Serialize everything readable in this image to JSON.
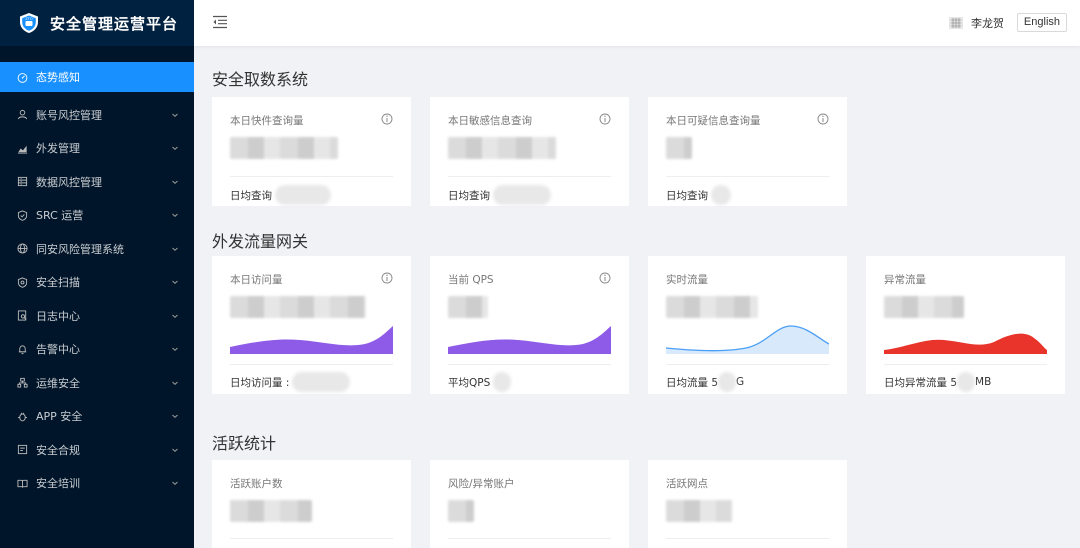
{
  "app": {
    "title": "安全管理运营平台"
  },
  "sidebar": {
    "items": [
      {
        "label": "态势感知",
        "icon": "dashboard-icon",
        "active": true
      },
      {
        "label": "账号风控管理",
        "icon": "user-icon"
      },
      {
        "label": "外发管理",
        "icon": "area-chart-icon"
      },
      {
        "label": "数据风控管理",
        "icon": "database-icon"
      },
      {
        "label": "SRC 运营",
        "icon": "shield-check-icon"
      },
      {
        "label": "同安风险管理系统",
        "icon": "global-icon"
      },
      {
        "label": "安全扫描",
        "icon": "safety-icon"
      },
      {
        "label": "日志中心",
        "icon": "file-search-icon"
      },
      {
        "label": "告警中心",
        "icon": "bell-icon"
      },
      {
        "label": "运维安全",
        "icon": "cluster-icon"
      },
      {
        "label": "APP 安全",
        "icon": "bug-icon"
      },
      {
        "label": "安全合规",
        "icon": "audit-icon"
      },
      {
        "label": "安全培训",
        "icon": "read-icon"
      }
    ]
  },
  "header": {
    "user_name": "李龙贺",
    "lang_button": "English"
  },
  "sections": {
    "s1": "安全取数系统",
    "s2": "外发流量网关",
    "s3": "活跃统计"
  },
  "cards": {
    "c1": {
      "label": "本日快件查询量",
      "footer": "日均查询"
    },
    "c2": {
      "label": "本日敏感信息查询",
      "footer": "日均查询"
    },
    "c3": {
      "label": "本日可疑信息查询量",
      "footer": "日均查询"
    },
    "c4": {
      "label": "本日访问量",
      "footer": "日均访问量 :"
    },
    "c5": {
      "label": "当前 QPS",
      "footer": "平均QPS"
    },
    "c6": {
      "label": "实时流量",
      "footer_pre": "日均流量 5",
      "footer_post": "G"
    },
    "c7": {
      "label": "异常流量",
      "footer_pre": "日均异常流量 5",
      "footer_post": "MB"
    },
    "c8": {
      "label": "活跃账户数"
    },
    "c9": {
      "label": "风险/异常账户"
    },
    "c10": {
      "label": "活跃网点"
    }
  },
  "colors": {
    "sidebar_bg": "#001529",
    "accent": "#1890ff",
    "purple": "#8e5ae8",
    "blue_line": "#4a9ff5",
    "red": "#e8342a"
  }
}
